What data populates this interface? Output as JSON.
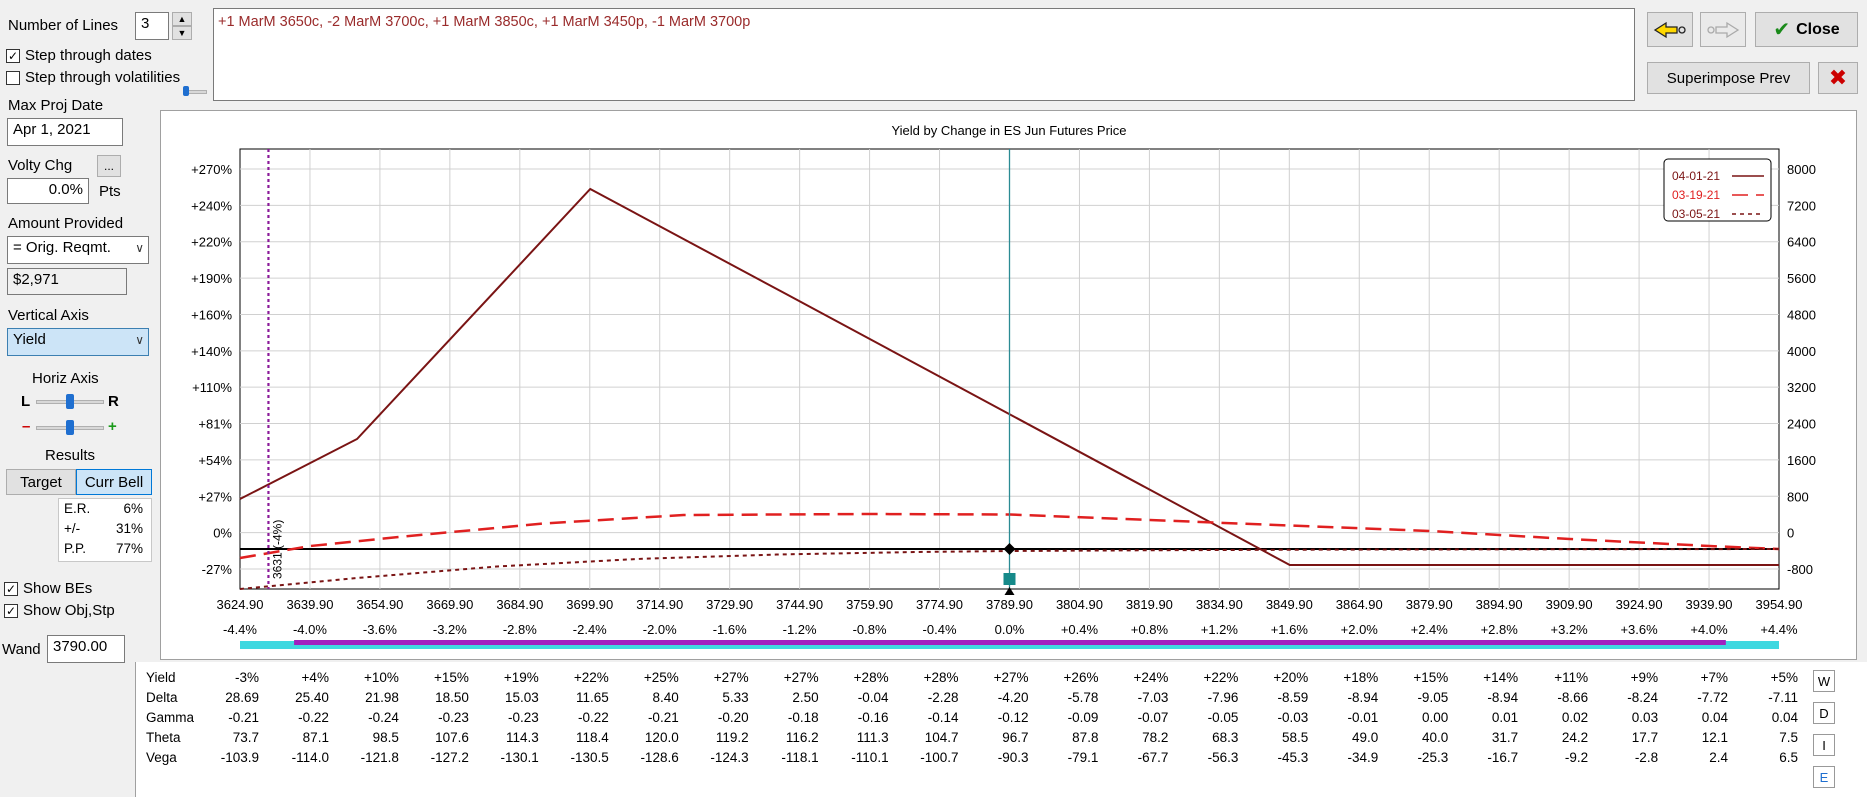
{
  "left_panel": {
    "num_lines_label": "Number of Lines",
    "num_lines_value": "3",
    "step_dates_label": "Step through dates",
    "step_dates_checked": true,
    "step_vols_label": "Step through volatilities",
    "step_vols_checked": false,
    "max_proj_label": "Max Proj Date",
    "max_proj_value": "Apr 1, 2021",
    "volty_label": "Volty Chg",
    "volty_button": "...",
    "volty_value": "0.0%",
    "volty_unit": "Pts",
    "amount_label": "Amount Provided",
    "amount_option": "= Orig. Reqmt.",
    "amount_value": "$2,971",
    "vaxis_label": "Vertical Axis",
    "vaxis_option": "Yield",
    "haxis_label": "Horiz Axis",
    "haxis_l": "L",
    "haxis_r": "R",
    "minus": "–",
    "plus": "+",
    "results_label": "Results",
    "target_btn": "Target",
    "currbell_btn": "Curr Bell",
    "stats": [
      {
        "k": "E.R.",
        "v": "6%"
      },
      {
        "k": "+/-",
        "v": "31%"
      },
      {
        "k": "P.P.",
        "v": "77%"
      }
    ],
    "show_bes_label": "Show BEs",
    "show_bes_checked": true,
    "show_obj_label": "Show Obj,Stp",
    "show_obj_checked": true,
    "wand_label": "Wand",
    "wand_value": "3790.00"
  },
  "top": {
    "position_text": "+1 MarM 3650c, -2 MarM 3700c, +1 MarM 3850c, +1 MarM 3450p, -1 MarM 3700p",
    "close_label": "Close",
    "superimpose_label": "Superimpose Prev",
    "colors": {
      "position_text": "#9a2b2b",
      "close_check": "#1a8a1a",
      "red_x": "#cc0000",
      "back_arrow": "#ffd800"
    }
  },
  "chart_data": {
    "type": "line",
    "title": "Yield by Change in ES Jun Futures Price",
    "x_ticks": [
      "3624.90",
      "3639.90",
      "3654.90",
      "3669.90",
      "3684.90",
      "3699.90",
      "3714.90",
      "3729.90",
      "3744.90",
      "3759.90",
      "3774.90",
      "3789.90",
      "3804.90",
      "3819.90",
      "3834.90",
      "3849.90",
      "3864.90",
      "3879.90",
      "3894.90",
      "3909.90",
      "3924.90",
      "3939.90",
      "3954.90"
    ],
    "x_pct_ticks": [
      "-4.4%",
      "-4.0%",
      "-3.6%",
      "-3.2%",
      "-2.8%",
      "-2.4%",
      "-2.0%",
      "-1.6%",
      "-1.2%",
      "-0.8%",
      "-0.4%",
      "0.0%",
      "+0.4%",
      "+0.8%",
      "+1.2%",
      "+1.6%",
      "+2.0%",
      "+2.4%",
      "+2.8%",
      "+3.2%",
      "+3.6%",
      "+4.0%",
      "+4.4%"
    ],
    "xlim": [
      3624.9,
      3954.9
    ],
    "y_left_ticks": [
      "+270%",
      "+240%",
      "+220%",
      "+190%",
      "+160%",
      "+140%",
      "+110%",
      "+81%",
      "+54%",
      "+27%",
      "0%",
      "-27%"
    ],
    "y_right_ticks": [
      "8000",
      "7200",
      "6400",
      "5600",
      "4800",
      "4000",
      "3200",
      "2400",
      "1600",
      "800",
      "0",
      "-800"
    ],
    "ylim": [
      -800,
      8000
    ],
    "legend_position": "top-right",
    "series": [
      {
        "name": "04-01-21",
        "color": "#7a1414",
        "dash": "solid",
        "x": [
          3624.9,
          3650,
          3700,
          3742,
          3850,
          3954.9
        ],
        "y": [
          1000,
          2200,
          7200,
          5100,
          -320,
          -320
        ]
      },
      {
        "name": "03-19-21",
        "color": "#e02020",
        "dash": "long",
        "x": [
          3624.9,
          3640,
          3660,
          3690,
          3720,
          3760,
          3790,
          3820,
          3850,
          3880,
          3910,
          3940,
          3954.9
        ],
        "y": [
          -180,
          60,
          250,
          510,
          680,
          700,
          690,
          580,
          470,
          360,
          200,
          60,
          0
        ]
      },
      {
        "name": "03-05-21",
        "color": "#7a1414",
        "dash": "short",
        "x": [
          3624.9,
          3650,
          3680,
          3710,
          3740,
          3770,
          3790,
          3820,
          3860,
          3954.9
        ],
        "y": [
          -800,
          -580,
          -350,
          -200,
          -110,
          -60,
          -40,
          -25,
          -12,
          0
        ]
      }
    ],
    "current_price": 3789.9,
    "be_marker": 3631,
    "be_label": "3631 (-4%)"
  },
  "table": {
    "row_labels": [
      "Yield",
      "Delta",
      "Gamma",
      "Theta",
      "Vega"
    ],
    "columns": [
      [
        "-3%",
        "28.69",
        "-0.21",
        "73.7",
        "-103.9"
      ],
      [
        "+4%",
        "25.40",
        "-0.22",
        "87.1",
        "-114.0"
      ],
      [
        "+10%",
        "21.98",
        "-0.24",
        "98.5",
        "-121.8"
      ],
      [
        "+15%",
        "18.50",
        "-0.23",
        "107.6",
        "-127.2"
      ],
      [
        "+19%",
        "15.03",
        "-0.23",
        "114.3",
        "-130.1"
      ],
      [
        "+22%",
        "11.65",
        "-0.22",
        "118.4",
        "-130.5"
      ],
      [
        "+25%",
        "8.40",
        "-0.21",
        "120.0",
        "-128.6"
      ],
      [
        "+27%",
        "5.33",
        "-0.20",
        "119.2",
        "-124.3"
      ],
      [
        "+27%",
        "2.50",
        "-0.18",
        "116.2",
        "-118.1"
      ],
      [
        "+28%",
        "-0.04",
        "-0.16",
        "111.3",
        "-110.1"
      ],
      [
        "+28%",
        "-2.28",
        "-0.14",
        "104.7",
        "-100.7"
      ],
      [
        "+27%",
        "-4.20",
        "-0.12",
        "96.7",
        "-90.3"
      ],
      [
        "+26%",
        "-5.78",
        "-0.09",
        "87.8",
        "-79.1"
      ],
      [
        "+24%",
        "-7.03",
        "-0.07",
        "78.2",
        "-67.7"
      ],
      [
        "+22%",
        "-7.96",
        "-0.05",
        "68.3",
        "-56.3"
      ],
      [
        "+20%",
        "-8.59",
        "-0.03",
        "58.5",
        "-45.3"
      ],
      [
        "+18%",
        "-8.94",
        "-0.01",
        "49.0",
        "-34.9"
      ],
      [
        "+15%",
        "-9.05",
        "0.00",
        "40.0",
        "-25.3"
      ],
      [
        "+14%",
        "-8.94",
        "0.01",
        "31.7",
        "-16.7"
      ],
      [
        "+11%",
        "-8.66",
        "0.02",
        "24.2",
        "-9.2"
      ],
      [
        "+9%",
        "-8.24",
        "0.03",
        "17.7",
        "-2.8"
      ],
      [
        "+7%",
        "-7.72",
        "0.04",
        "12.1",
        "2.4"
      ],
      [
        "+5%",
        "-7.11",
        "0.04",
        "7.5",
        "6.5"
      ]
    ],
    "side_icons": [
      "W",
      "D",
      "I",
      "E"
    ]
  }
}
